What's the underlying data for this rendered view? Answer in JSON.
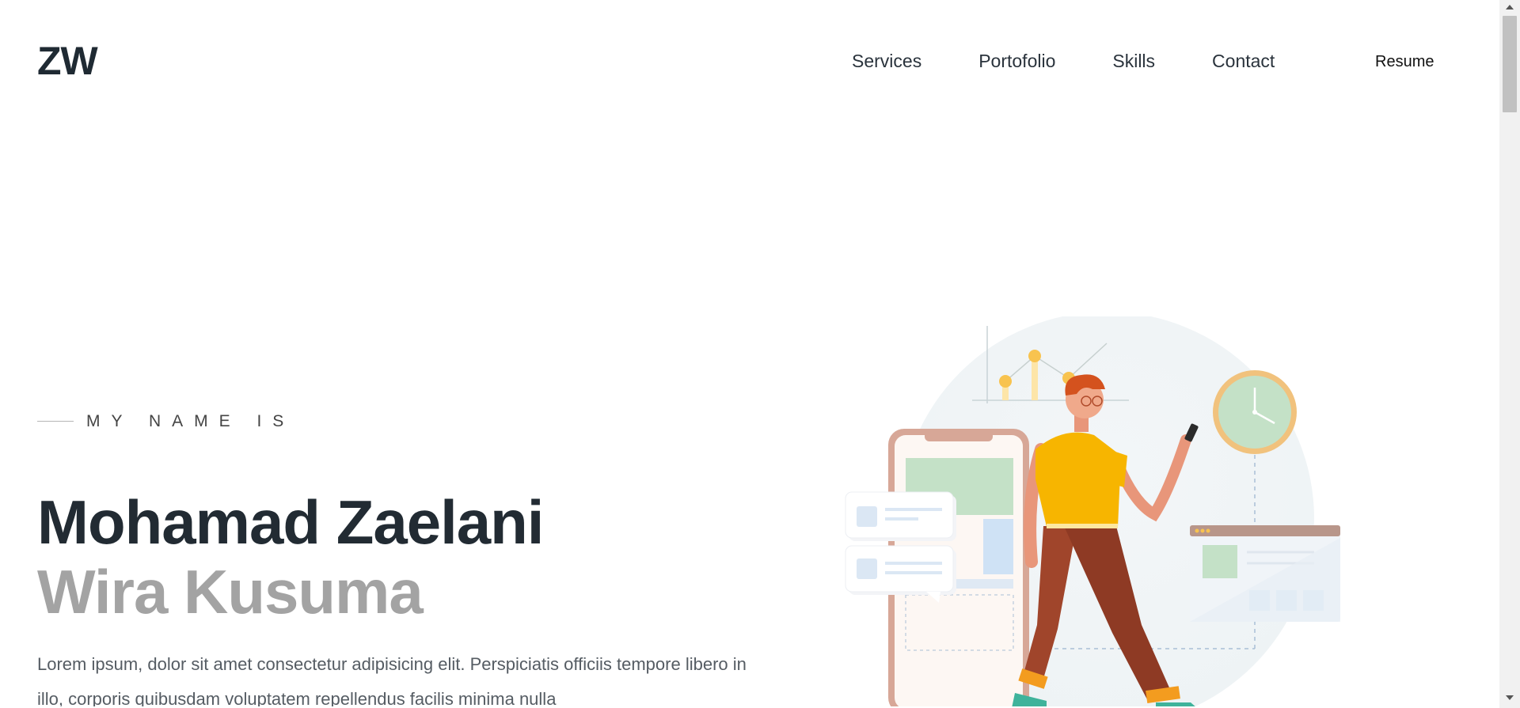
{
  "header": {
    "logo": "ZW",
    "nav": [
      "Services",
      "Portofolio",
      "Skills",
      "Contact"
    ],
    "resume_label": "Resume"
  },
  "hero": {
    "eyebrow": "MY NAME IS",
    "name_first": "Mohamad Zaelani",
    "name_last": "Wira Kusuma",
    "description": "Lorem ipsum, dolor sit amet consectetur adipisicing elit. Perspiciatis officiis tempore libero in illo, corporis quibusdam voluptatem repellendus facilis minima nulla",
    "illustration": "person-walking-with-phone-illustration"
  },
  "colors": {
    "text_dark": "#222b33",
    "text_muted": "#a3a3a3",
    "shirt": "#f7b500",
    "pants": "#a0452b",
    "accent_green": "#bfe0c4",
    "clock_ring": "#f1c27d"
  },
  "icons": {
    "scroll_up": "chevron-up-icon",
    "scroll_down": "chevron-down-icon"
  }
}
